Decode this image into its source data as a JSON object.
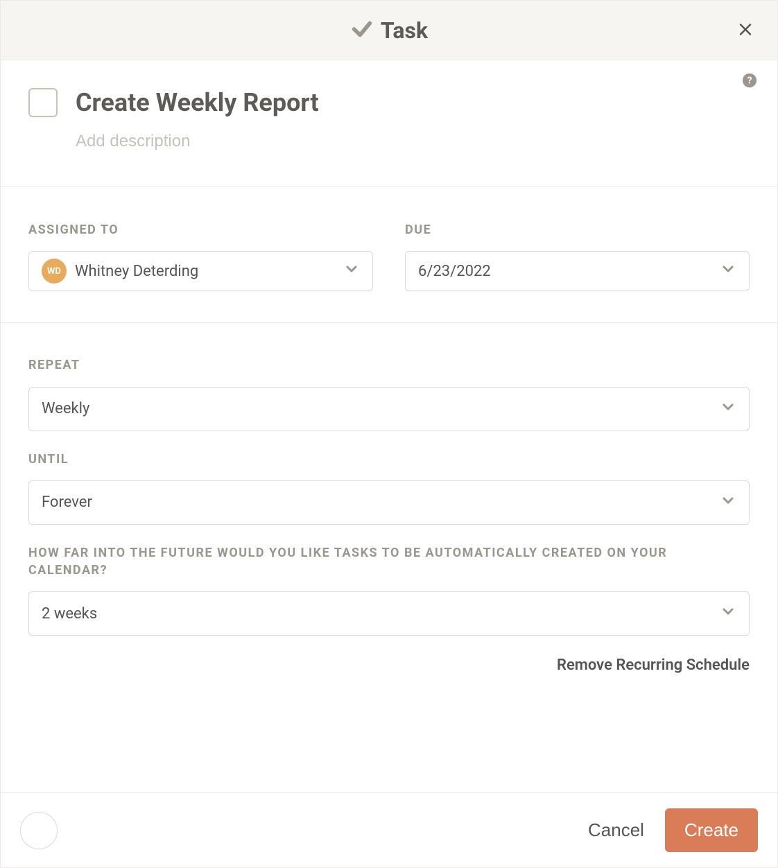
{
  "header": {
    "title": "Task"
  },
  "task": {
    "title": "Create Weekly Report",
    "description_placeholder": "Add description"
  },
  "fields": {
    "assigned_to_label": "ASSIGNED TO",
    "assignee_initials": "WD",
    "assignee_name": "Whitney Deterding",
    "due_label": "DUE",
    "due_date": "6/23/2022",
    "repeat_label": "REPEAT",
    "repeat_value": "Weekly",
    "until_label": "UNTIL",
    "until_value": "Forever",
    "future_label": "HOW FAR INTO THE FUTURE WOULD YOU LIKE TASKS TO BE AUTOMATICALLY CREATED ON YOUR CALENDAR?",
    "future_value": "2 weeks",
    "remove_link": "Remove Recurring Schedule"
  },
  "footer": {
    "cancel": "Cancel",
    "create": "Create"
  }
}
